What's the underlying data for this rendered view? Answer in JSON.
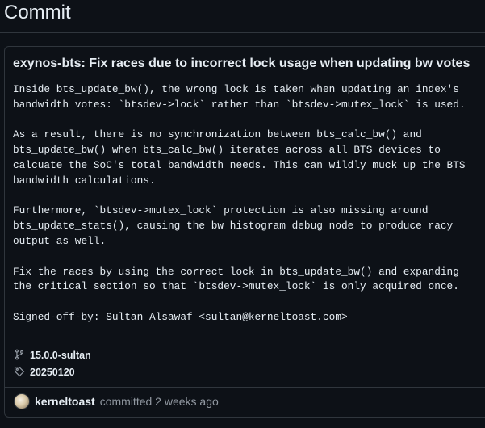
{
  "page": {
    "title": "Commit"
  },
  "commit": {
    "title": "exynos-bts: Fix races due to incorrect lock usage when updating bw votes",
    "message": "Inside bts_update_bw(), the wrong lock is taken when updating an index's\nbandwidth votes: `btsdev->lock` rather than `btsdev->mutex_lock` is used.\n\nAs a result, there is no synchronization between bts_calc_bw() and\nbts_update_bw() when bts_calc_bw() iterates across all BTS devices to\ncalcuate the SoC's total bandwidth needs. This can wildly muck up the BTS\nbandwidth calculations.\n\nFurthermore, `btsdev->mutex_lock` protection is also missing around\nbts_update_stats(), causing the bw histogram debug node to produce racy\noutput as well.\n\nFix the races by using the correct lock in bts_update_bw() and expanding\nthe critical section so that `btsdev->mutex_lock` is only acquired once.\n\nSigned-off-by: Sultan Alsawaf <sultan@kerneltoast.com>",
    "branch": "15.0.0-sultan",
    "tag": "20250120",
    "author": "kerneltoast",
    "committed_text": "committed 2 weeks ago"
  },
  "icons": {
    "branch": "git-branch-icon",
    "tag": "tag-icon",
    "avatar": "avatar"
  },
  "colors": {
    "background": "#0d1117",
    "border": "#30363d",
    "text": "#e6edf3",
    "muted": "#9198a1"
  }
}
